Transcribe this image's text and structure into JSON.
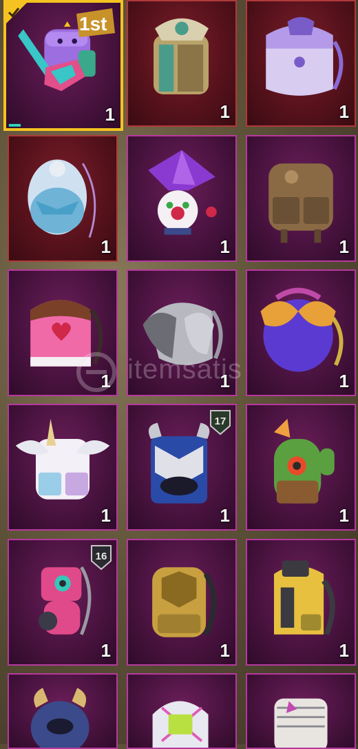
{
  "inventory": {
    "items": [
      {
        "id": "bag-1",
        "quantity": "1",
        "frame": "selected",
        "badge": "1st",
        "icon": "guitar-backpack-icon",
        "colors": [
          "#9c6ee0",
          "#38c6c6",
          "#e24f8a"
        ]
      },
      {
        "id": "bag-2",
        "quantity": "1",
        "frame": "red",
        "icon": "ornate-gold-backpack-icon",
        "colors": [
          "#b9a36a",
          "#4a9c8a",
          "#d9d0b0"
        ]
      },
      {
        "id": "bag-3",
        "quantity": "1",
        "frame": "red",
        "icon": "lavender-backpack-icon",
        "colors": [
          "#b49ae8",
          "#7a5cc8",
          "#e0d4f4"
        ]
      },
      {
        "id": "bag-4",
        "quantity": "1",
        "frame": "red",
        "icon": "ribbon-egg-backpack-icon",
        "colors": [
          "#cfe0f0",
          "#6fb3d6",
          "#b28ad4"
        ]
      },
      {
        "id": "bag-5",
        "quantity": "1",
        "frame": "purple",
        "icon": "jester-backpack-icon",
        "colors": [
          "#8a3ad0",
          "#ffffff",
          "#d02848"
        ]
      },
      {
        "id": "bag-6",
        "quantity": "1",
        "frame": "purple",
        "icon": "leather-backpack-icon",
        "colors": [
          "#8a6a44",
          "#5e4630",
          "#b08e62"
        ]
      },
      {
        "id": "bag-7",
        "quantity": "1",
        "frame": "purple",
        "icon": "love-cake-backpack-icon",
        "colors": [
          "#f06aa8",
          "#7a4028",
          "#f4f0f4"
        ]
      },
      {
        "id": "bag-8",
        "quantity": "1",
        "frame": "purple",
        "icon": "silver-feather-backpack-icon",
        "colors": [
          "#b8b8c0",
          "#6c6c74",
          "#e0e0e8"
        ]
      },
      {
        "id": "bag-9",
        "quantity": "1",
        "frame": "purple",
        "icon": "winged-scale-backpack-icon",
        "colors": [
          "#5a3ad0",
          "#e8a038",
          "#c04aa8"
        ]
      },
      {
        "id": "bag-10",
        "quantity": "1",
        "frame": "purple",
        "icon": "unicorn-backpack-icon",
        "colors": [
          "#f4f0f8",
          "#9acde8",
          "#c8a8e0"
        ]
      },
      {
        "id": "bag-11",
        "quantity": "1",
        "frame": "purple",
        "badge": "17",
        "icon": "blue-mask-backpack-icon",
        "colors": [
          "#2a4aa8",
          "#e0e0e8",
          "#1a1a2a"
        ]
      },
      {
        "id": "bag-12",
        "quantity": "1",
        "frame": "purple",
        "icon": "cactus-backpack-icon",
        "colors": [
          "#5aa040",
          "#8a5a30",
          "#e84a2a"
        ]
      },
      {
        "id": "bag-13",
        "quantity": "1",
        "frame": "purple",
        "badge": "16",
        "icon": "pink-robot-backpack-icon",
        "colors": [
          "#e04a8a",
          "#38c6b8",
          "#3a3a48"
        ]
      },
      {
        "id": "bag-14",
        "quantity": "1",
        "frame": "purple",
        "icon": "gold-armor-backpack-icon",
        "colors": [
          "#c8a040",
          "#8a6a20",
          "#2a2a30"
        ]
      },
      {
        "id": "bag-15",
        "quantity": "1",
        "frame": "purple",
        "icon": "yellow-tech-backpack-icon",
        "colors": [
          "#e8c040",
          "#3a3a40",
          "#a08a30"
        ]
      },
      {
        "id": "bag-16",
        "quantity": "",
        "frame": "purple",
        "icon": "dark-horned-backpack-icon",
        "colors": [
          "#3a4a8a",
          "#d8b870",
          "#1a1a30"
        ]
      },
      {
        "id": "bag-17",
        "quantity": "",
        "frame": "purple",
        "icon": "neon-strap-backpack-icon",
        "colors": [
          "#e8e8f0",
          "#b8e040",
          "#e05ab8"
        ]
      },
      {
        "id": "bag-18",
        "quantity": "",
        "frame": "purple",
        "icon": "bandaged-backpack-icon",
        "colors": [
          "#e8e4e0",
          "#c04ab0",
          "#8a8a90"
        ]
      }
    ]
  },
  "watermark": {
    "text": "itemsatis"
  }
}
